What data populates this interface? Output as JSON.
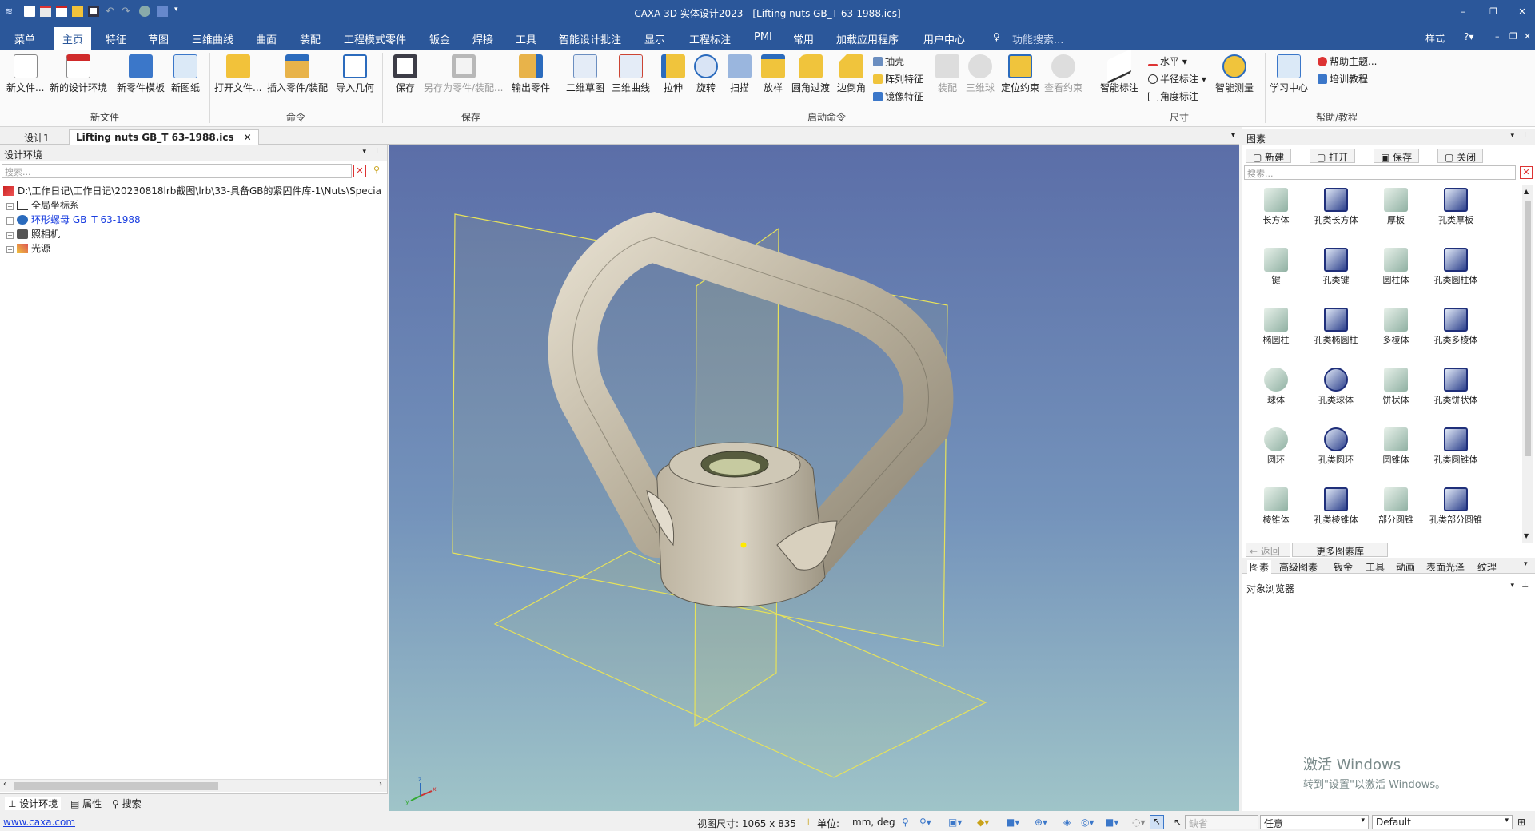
{
  "app": {
    "title": "CAXA 3D 实体设计2023 - [Lifting nuts GB_T 63-1988.ics]"
  },
  "menu": [
    "菜单",
    "主页",
    "特征",
    "草图",
    "三维曲线",
    "曲面",
    "装配",
    "工程模式零件",
    "钣金",
    "焊接",
    "工具",
    "智能设计批注",
    "显示",
    "工程标注",
    "PMI",
    "常用",
    "加载应用程序",
    "用户中心"
  ],
  "menu_search": "功能搜索...",
  "style_label": "样式",
  "ribbon": {
    "new_file": {
      "buttons": [
        "新文件...",
        "新的设计环境",
        "新零件模板",
        "新图纸"
      ],
      "label": "新文件"
    },
    "command": {
      "buttons": [
        "打开文件...",
        "插入零件/装配",
        "导入几何"
      ],
      "label": "命令"
    },
    "save": {
      "buttons": [
        "保存",
        "另存为零件/装配...",
        "输出零件"
      ],
      "label": "保存"
    },
    "launch": {
      "buttons": [
        "二维草图",
        "三维曲线",
        "拉伸",
        "旋转",
        "扫描",
        "放样",
        "圆角过渡",
        "边倒角"
      ],
      "small": [
        "抽壳",
        "阵列特征",
        "镜像特征"
      ],
      "disabled": [
        "装配",
        "三维球",
        "查看约束"
      ],
      "extra": "定位约束",
      "label": "启动命令"
    },
    "dimension": {
      "big": "智能标注",
      "small": [
        "水平",
        "半径标注",
        "角度标注"
      ],
      "big2": "智能测量",
      "label": "尺寸"
    },
    "help": {
      "big": "学习中心",
      "small": [
        "帮助主题...",
        "培训教程"
      ],
      "label": "帮助/教程"
    }
  },
  "doc_tabs": [
    "设计1",
    "Lifting nuts GB_T 63-1988.ics"
  ],
  "left_panel": {
    "title": "设计环境",
    "search_placeholder": "搜索...",
    "path": "D:\\工作日记\\工作日记\\20230818lrb截图\\lrb\\33-具备GB的紧固件库-1\\Nuts\\Specia",
    "tree": [
      "全局坐标系",
      "环形螺母 GB_T 63-1988",
      "照相机",
      "光源"
    ],
    "tabs": [
      "设计环境",
      "属性",
      "搜索"
    ]
  },
  "right_panel": {
    "title": "图素",
    "toolbar": [
      "新建",
      "打开",
      "保存",
      "关闭"
    ],
    "search_placeholder": "搜索...",
    "items": [
      "长方体",
      "孔类长方体",
      "厚板",
      "孔类厚板",
      "键",
      "孔类键",
      "圆柱体",
      "孔类圆柱体",
      "椭圆柱",
      "孔类椭圆柱",
      "多棱体",
      "孔类多棱体",
      "球体",
      "孔类球体",
      "饼状体",
      "孔类饼状体",
      "圆环",
      "孔类圆环",
      "圆锥体",
      "孔类圆锥体",
      "棱锥体",
      "孔类棱锥体",
      "部分圆锥",
      "孔类部分圆锥"
    ],
    "back": "返回",
    "more": "更多图素库",
    "tabs": [
      "图素",
      "高级图素",
      "钣金",
      "工具",
      "动画",
      "表面光泽",
      "纹理"
    ],
    "object_browser": "对象浏览器"
  },
  "watermark": {
    "line1": "激活 Windows",
    "line2": "转到\"设置\"以激活 Windows。"
  },
  "status": {
    "url": "www.caxa.com",
    "view_size": "视图尺寸: 1065 x 835",
    "unit_label": "单位:",
    "unit_value": "mm, deg",
    "combo1": "缺省",
    "combo2": "任意",
    "combo3": "Default"
  },
  "colors": {
    "title_bg": "#2b579a",
    "nut_body": "#c9c1af",
    "plane_outline": "#e7e25a",
    "viewport_top": "#5b6ea8",
    "viewport_bottom": "#9fc4c8"
  }
}
